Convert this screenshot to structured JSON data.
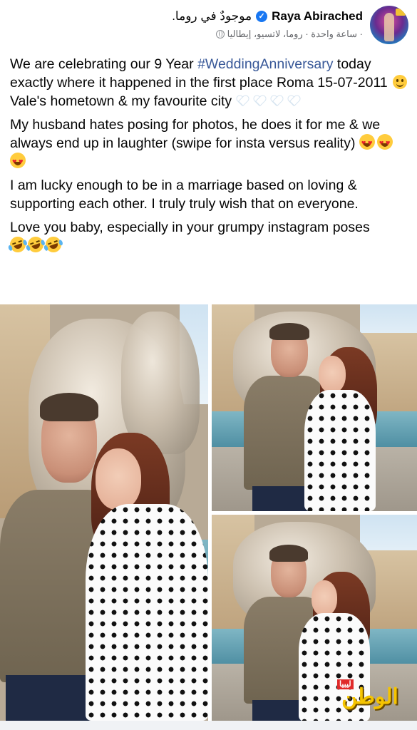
{
  "post": {
    "author": "Raya Abirached",
    "checkin": "موجودٌ في روما.",
    "meta": "ساعة واحدة · روما، لاتسيو، إيطاليا ·",
    "paragraphs": [
      {
        "segments": [
          {
            "text": "We are celebrating our 9 Year ",
            "type": "text"
          },
          {
            "text": "#WeddingAnniversary",
            "type": "hashtag"
          },
          {
            "text": " today exactly where it happened in the first place Roma 15-07-2011",
            "type": "text"
          }
        ],
        "trailing_emoji": "slightly-smiling-face",
        "line2": "Vale's hometown & my favourite city",
        "line2_emoji": [
          "white-heart",
          "white-heart",
          "white-heart",
          "white-heart"
        ]
      },
      {
        "text": "My husband hates posing for photos, he does it for me & we always end up in laughter (swipe for insta versus reality)",
        "emoji": [
          "heart-eyes",
          "heart-eyes",
          "heart-eyes"
        ]
      },
      {
        "text": "I am lucky enough to be in a marriage based on loving & supporting each other. I truly truly wish that on everyone."
      },
      {
        "text": "Love you baby, especially in your grumpy instagram poses",
        "emoji": [
          "rolling-laughing",
          "rolling-laughing",
          "rolling-laughing"
        ]
      }
    ]
  },
  "photos": [
    {
      "name": "couple-photo-fountain-closeup"
    },
    {
      "name": "couple-photo-fountain-standing"
    },
    {
      "name": "couple-photo-fountain-wide"
    }
  ],
  "watermark": {
    "small": "ليبيا",
    "big": "الوطن"
  },
  "colors": {
    "hashtag": "#385898",
    "verified": "#1877f2",
    "text": "#050505",
    "meta": "#65676b"
  }
}
